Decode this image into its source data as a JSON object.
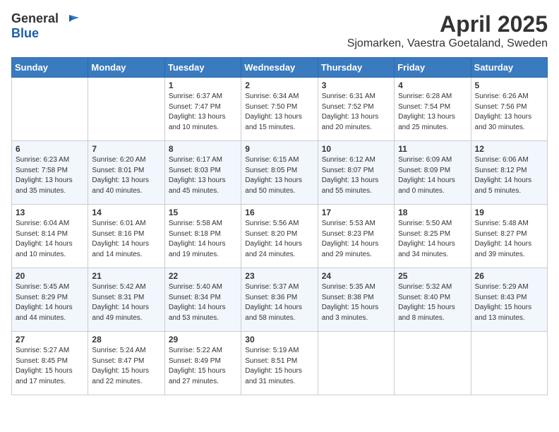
{
  "header": {
    "logo_general": "General",
    "logo_blue": "Blue",
    "title": "April 2025",
    "subtitle": "Sjomarken, Vaestra Goetaland, Sweden"
  },
  "weekdays": [
    "Sunday",
    "Monday",
    "Tuesday",
    "Wednesday",
    "Thursday",
    "Friday",
    "Saturday"
  ],
  "weeks": [
    [
      {
        "day": "",
        "info": ""
      },
      {
        "day": "",
        "info": ""
      },
      {
        "day": "1",
        "info": "Sunrise: 6:37 AM\nSunset: 7:47 PM\nDaylight: 13 hours and 10 minutes."
      },
      {
        "day": "2",
        "info": "Sunrise: 6:34 AM\nSunset: 7:50 PM\nDaylight: 13 hours and 15 minutes."
      },
      {
        "day": "3",
        "info": "Sunrise: 6:31 AM\nSunset: 7:52 PM\nDaylight: 13 hours and 20 minutes."
      },
      {
        "day": "4",
        "info": "Sunrise: 6:28 AM\nSunset: 7:54 PM\nDaylight: 13 hours and 25 minutes."
      },
      {
        "day": "5",
        "info": "Sunrise: 6:26 AM\nSunset: 7:56 PM\nDaylight: 13 hours and 30 minutes."
      }
    ],
    [
      {
        "day": "6",
        "info": "Sunrise: 6:23 AM\nSunset: 7:58 PM\nDaylight: 13 hours and 35 minutes."
      },
      {
        "day": "7",
        "info": "Sunrise: 6:20 AM\nSunset: 8:01 PM\nDaylight: 13 hours and 40 minutes."
      },
      {
        "day": "8",
        "info": "Sunrise: 6:17 AM\nSunset: 8:03 PM\nDaylight: 13 hours and 45 minutes."
      },
      {
        "day": "9",
        "info": "Sunrise: 6:15 AM\nSunset: 8:05 PM\nDaylight: 13 hours and 50 minutes."
      },
      {
        "day": "10",
        "info": "Sunrise: 6:12 AM\nSunset: 8:07 PM\nDaylight: 13 hours and 55 minutes."
      },
      {
        "day": "11",
        "info": "Sunrise: 6:09 AM\nSunset: 8:09 PM\nDaylight: 14 hours and 0 minutes."
      },
      {
        "day": "12",
        "info": "Sunrise: 6:06 AM\nSunset: 8:12 PM\nDaylight: 14 hours and 5 minutes."
      }
    ],
    [
      {
        "day": "13",
        "info": "Sunrise: 6:04 AM\nSunset: 8:14 PM\nDaylight: 14 hours and 10 minutes."
      },
      {
        "day": "14",
        "info": "Sunrise: 6:01 AM\nSunset: 8:16 PM\nDaylight: 14 hours and 14 minutes."
      },
      {
        "day": "15",
        "info": "Sunrise: 5:58 AM\nSunset: 8:18 PM\nDaylight: 14 hours and 19 minutes."
      },
      {
        "day": "16",
        "info": "Sunrise: 5:56 AM\nSunset: 8:20 PM\nDaylight: 14 hours and 24 minutes."
      },
      {
        "day": "17",
        "info": "Sunrise: 5:53 AM\nSunset: 8:23 PM\nDaylight: 14 hours and 29 minutes."
      },
      {
        "day": "18",
        "info": "Sunrise: 5:50 AM\nSunset: 8:25 PM\nDaylight: 14 hours and 34 minutes."
      },
      {
        "day": "19",
        "info": "Sunrise: 5:48 AM\nSunset: 8:27 PM\nDaylight: 14 hours and 39 minutes."
      }
    ],
    [
      {
        "day": "20",
        "info": "Sunrise: 5:45 AM\nSunset: 8:29 PM\nDaylight: 14 hours and 44 minutes."
      },
      {
        "day": "21",
        "info": "Sunrise: 5:42 AM\nSunset: 8:31 PM\nDaylight: 14 hours and 49 minutes."
      },
      {
        "day": "22",
        "info": "Sunrise: 5:40 AM\nSunset: 8:34 PM\nDaylight: 14 hours and 53 minutes."
      },
      {
        "day": "23",
        "info": "Sunrise: 5:37 AM\nSunset: 8:36 PM\nDaylight: 14 hours and 58 minutes."
      },
      {
        "day": "24",
        "info": "Sunrise: 5:35 AM\nSunset: 8:38 PM\nDaylight: 15 hours and 3 minutes."
      },
      {
        "day": "25",
        "info": "Sunrise: 5:32 AM\nSunset: 8:40 PM\nDaylight: 15 hours and 8 minutes."
      },
      {
        "day": "26",
        "info": "Sunrise: 5:29 AM\nSunset: 8:43 PM\nDaylight: 15 hours and 13 minutes."
      }
    ],
    [
      {
        "day": "27",
        "info": "Sunrise: 5:27 AM\nSunset: 8:45 PM\nDaylight: 15 hours and 17 minutes."
      },
      {
        "day": "28",
        "info": "Sunrise: 5:24 AM\nSunset: 8:47 PM\nDaylight: 15 hours and 22 minutes."
      },
      {
        "day": "29",
        "info": "Sunrise: 5:22 AM\nSunset: 8:49 PM\nDaylight: 15 hours and 27 minutes."
      },
      {
        "day": "30",
        "info": "Sunrise: 5:19 AM\nSunset: 8:51 PM\nDaylight: 15 hours and 31 minutes."
      },
      {
        "day": "",
        "info": ""
      },
      {
        "day": "",
        "info": ""
      },
      {
        "day": "",
        "info": ""
      }
    ]
  ]
}
